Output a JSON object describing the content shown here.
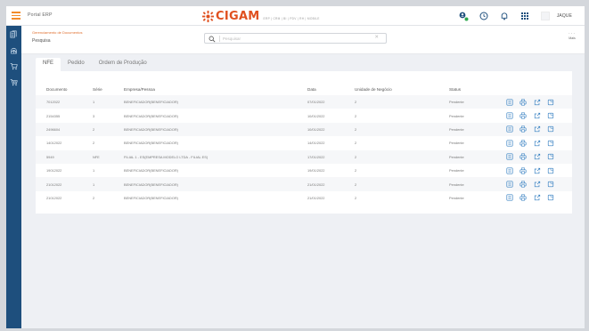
{
  "topbar": {
    "portal_title": "Portal ERP",
    "brand": "CIGAM",
    "brand_sub": "ERP | CRM | BI | PDV | RH | MOBILE",
    "user_name": "JAQUE",
    "accent": "#f28b2b",
    "brand_color": "#e0501f"
  },
  "sidebar": {
    "color": "#1e4f7d",
    "items": [
      {
        "icon": "document-stack-icon"
      },
      {
        "icon": "fingerprint-icon"
      },
      {
        "icon": "cart-icon"
      },
      {
        "icon": "cart-outline-icon"
      }
    ]
  },
  "header": {
    "breadcrumb": "Gerenciamento de Documentos",
    "title": "Pesquisa",
    "search_placeholder": "Pesquisar",
    "more_label": "Mais"
  },
  "tabs": [
    {
      "label": "NFE",
      "active": true
    },
    {
      "label": "Pedido",
      "active": false
    },
    {
      "label": "Ordem de Produção",
      "active": false
    }
  ],
  "table": {
    "columns": [
      "Documento",
      "Série",
      "Empresa/Pessoa",
      "Data",
      "Unidade de Negócio",
      "Status"
    ],
    "rows": [
      {
        "documento": "7012022",
        "serie": "1",
        "empresa": "BENEFICIADOR(BENEFICIADOR)",
        "data": "07/01/2022",
        "unidade": "2",
        "status": "Pendente"
      },
      {
        "documento": "2154355",
        "serie": "3",
        "empresa": "BENEFICIADOR(BENEFICIADOR)",
        "data": "10/01/2022",
        "unidade": "2",
        "status": "Pendente"
      },
      {
        "documento": "2496604",
        "serie": "2",
        "empresa": "BENEFICIADOR(BENEFICIADOR)",
        "data": "10/01/2022",
        "unidade": "2",
        "status": "Pendente"
      },
      {
        "documento": "14012022",
        "serie": "2",
        "empresa": "BENEFICIADOR(BENEFICIADOR)",
        "data": "14/01/2022",
        "unidade": "2",
        "status": "Pendente"
      },
      {
        "documento": "5949",
        "serie": "NFE",
        "empresa": "FILIAL 1 - ES(EMPRESA MODELO LTDA - FILIAL ES)",
        "data": "17/01/2022",
        "unidade": "2",
        "status": "Pendente"
      },
      {
        "documento": "19012022",
        "serie": "1",
        "empresa": "BENEFICIADOR(BENEFICIADOR)",
        "data": "19/01/2022",
        "unidade": "2",
        "status": "Pendente"
      },
      {
        "documento": "21012022",
        "serie": "1",
        "empresa": "BENEFICIADOR(BENEFICIADOR)",
        "data": "21/01/2022",
        "unidade": "2",
        "status": "Pendente"
      },
      {
        "documento": "21012022",
        "serie": "2",
        "empresa": "BENEFICIADOR(BENEFICIADOR)",
        "data": "21/01/2022",
        "unidade": "2",
        "status": "Pendente"
      }
    ],
    "row_actions": [
      "details-icon",
      "print-icon",
      "export-icon",
      "open-icon"
    ]
  }
}
